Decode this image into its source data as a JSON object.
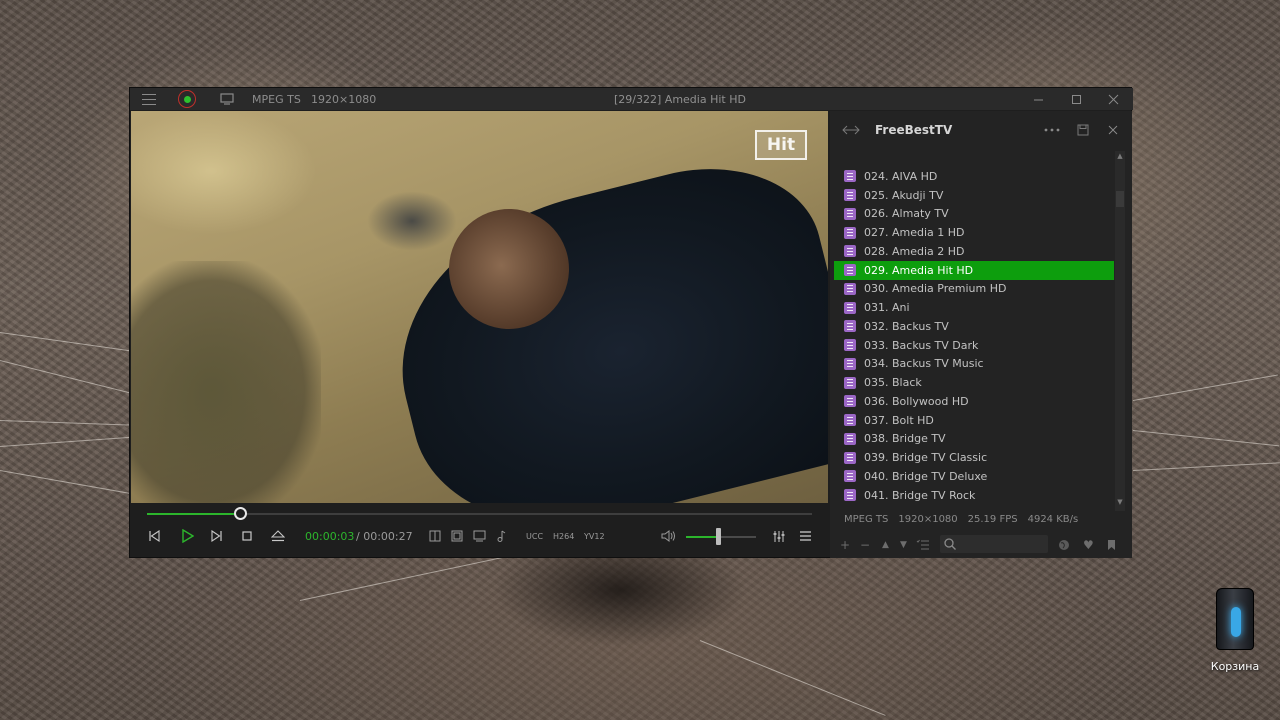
{
  "titlebar": {
    "format": "MPEG TS",
    "resolution": "1920×1080",
    "title": "[29/322] Amedia Hit HD"
  },
  "video": {
    "channel_logo": "Hit"
  },
  "playback": {
    "progress": 0.14,
    "current_time": "00:00:03",
    "total_time": "/ 00:00:27",
    "volume": 0.45,
    "codecs": [
      "UCC",
      "H264",
      "YV12"
    ]
  },
  "icons": {
    "menu": "hamburger-icon",
    "record": "record-icon",
    "monitor": "monitor-icon",
    "prev": "skip-previous-icon",
    "play": "play-icon",
    "next": "skip-next-icon",
    "stop": "stop-icon",
    "eject": "eject-icon",
    "volume": "speaker-icon",
    "equalizer": "equalizer-icon",
    "playlist": "playlist-icon",
    "file": "playlist-file-icon"
  },
  "colors": {
    "accent": "#2cb52c",
    "active_row": "#0d9e0d",
    "file_icon": "#9b67c6"
  },
  "playlist": {
    "title": "FreeBestTV",
    "active_index": 5,
    "items": [
      "024. AIVA HD",
      "025. Akudji TV",
      "026. Almaty TV",
      "027. Amedia 1 HD",
      "028. Amedia 2 HD",
      "029. Amedia Hit HD",
      "030. Amedia Premium HD",
      "031. Ani",
      "032. Backus TV",
      "033. Backus TV Dark",
      "034. Backus TV Music",
      "035. Black",
      "036. Bollywood HD",
      "037. Bolt HD",
      "038. Bridge TV",
      "039. Bridge TV Classic",
      "040. Bridge TV Deluxe",
      "041. Bridge TV Rock"
    ],
    "status": {
      "format": "MPEG TS",
      "resolution": "1920×1080",
      "fps": "25.19 FPS",
      "bitrate": "4924 KB/s"
    },
    "search_placeholder": ""
  },
  "desktop": {
    "recycle_bin_label": "Корзина"
  }
}
